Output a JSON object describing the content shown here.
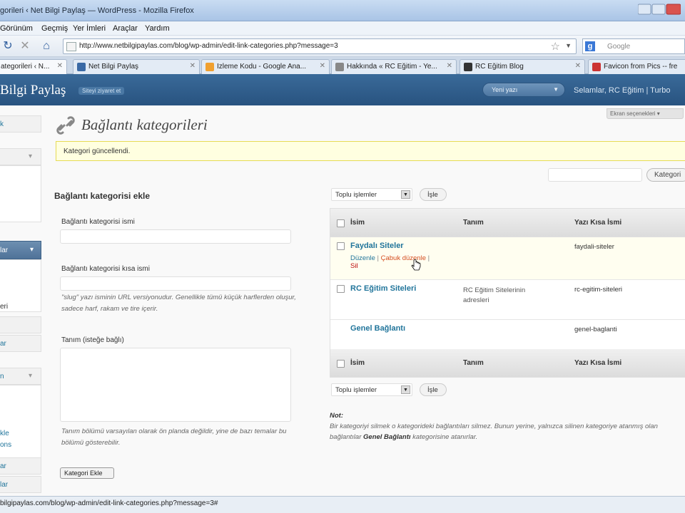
{
  "browser": {
    "window_title": "gorileri ‹ Net Bilgi Paylaş — WordPress - Mozilla Firefox",
    "menu": [
      "Görünüm",
      "Geçmiş",
      "Yer İmleri",
      "Araçlar",
      "Yardım"
    ],
    "url": "http://www.netbilgipaylas.com/blog/wp-admin/edit-link-categories.php?message=3",
    "search_placeholder": "Google",
    "tabs": [
      {
        "label": "ategorileri ‹ N..."
      },
      {
        "label": "Net Bilgi Paylaş"
      },
      {
        "label": "İzleme Kodu - Google Ana..."
      },
      {
        "label": "Hakkında « RC Eğitim - Ye..."
      },
      {
        "label": "RC Eğitim Blog"
      },
      {
        "label": "Favicon from Pics -- fre"
      }
    ],
    "status": "bilgipaylas.com/blog/wp-admin/edit-link-categories.php?message=3#"
  },
  "wp_header": {
    "site_title": "Bilgi Paylaş",
    "visit_site": "Siteyi ziyaret et",
    "new_post": "Yeni yazı",
    "greeting": "Selamlar, RC Eğitim | Turbo"
  },
  "sidebar": {
    "fragments": [
      "k",
      "lar",
      "eri",
      "ar",
      "ar",
      "n",
      "kle",
      "ons",
      "ar",
      "lar"
    ]
  },
  "screen_options": "Ekran seçenekleri ▾",
  "page": {
    "title": "Bağlantı kategorileri",
    "notice": "Kategori güncellendi.",
    "search_button": "Kategori"
  },
  "form": {
    "heading": "Bağlantı kategorisi ekle",
    "name_label": "Bağlantı kategorisi ismi",
    "slug_label": "Bağlantı kategorisi kısa ismi",
    "slug_help": "\"slug\" yazı isminin URL versiyonudur. Genellikle tümü küçük harflerden oluşur, sadece harf, rakam ve tire içerir.",
    "desc_label": "Tanım (isteğe bağlı)",
    "desc_help": "Tanım bölümü varsayılan olarak ön planda değildir, yine de bazı temalar bu bölümü gösterebilir.",
    "submit": "Kategori Ekle"
  },
  "bulk": {
    "select_label": "Toplu işlemler",
    "apply": "İşle"
  },
  "table": {
    "columns": [
      "İsim",
      "Tanım",
      "Yazı Kısa İsmi"
    ],
    "rows": [
      {
        "name": "Faydalı Siteler",
        "description": "",
        "slug": "faydali-siteler",
        "actions": {
          "edit": "Düzenle",
          "quick_edit": "Çabuk düzenle",
          "delete": "Sil"
        }
      },
      {
        "name": "RC Eğitim Siteleri",
        "description": "RC Eğitim Sitelerinin adresleri",
        "slug": "rc-egitim-siteleri"
      },
      {
        "name": "Genel Bağlantı",
        "description": "",
        "slug": "genel-baglanti"
      }
    ]
  },
  "note": {
    "title": "Not:",
    "text_before": "Bir kategoriyi silmek o kategorideki bağlantıları silmez. Bunun yerine, yalnızca silinen kategoriye atanmış olan bağlantılar ",
    "bold": "Genel Bağlantı",
    "text_after": " kategorisine atanırlar."
  },
  "colors": {
    "wp_header": "#285380",
    "link": "#21759b",
    "notice_bg": "#ffffe0",
    "delete": "#bc0b0b"
  }
}
